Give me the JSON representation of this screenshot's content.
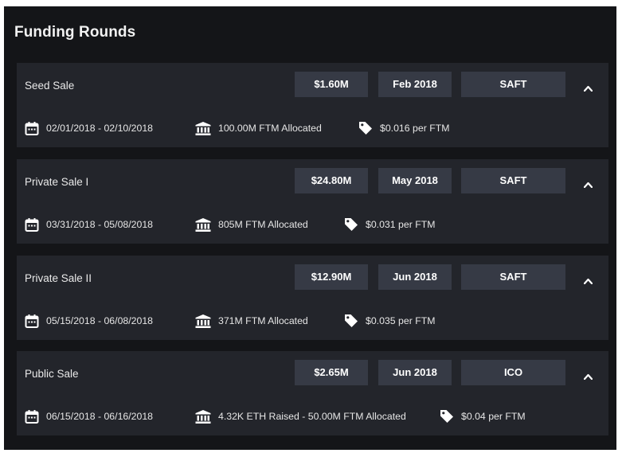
{
  "page": {
    "title": "Funding Rounds"
  },
  "icons": {
    "period": "calendar-icon",
    "allocation": "bank-icon",
    "price": "price-tag-icon",
    "toggle": "chevron-up-icon"
  },
  "colors": {
    "panel_background": "#141518",
    "card_background": "#23252b",
    "tag_background": "#363a45",
    "text": "#e9e9e9"
  },
  "rounds": [
    {
      "name": "Seed Sale",
      "amount": "$1.60M",
      "date": "Feb 2018",
      "type": "SAFT",
      "period": "02/01/2018 - 02/10/2018",
      "allocation": "100.00M FTM Allocated",
      "price": "$0.016 per FTM",
      "expanded": true
    },
    {
      "name": "Private Sale I",
      "amount": "$24.80M",
      "date": "May 2018",
      "type": "SAFT",
      "period": "03/31/2018 - 05/08/2018",
      "allocation": "805M FTM Allocated",
      "price": "$0.031 per FTM",
      "expanded": true
    },
    {
      "name": "Private Sale II",
      "amount": "$12.90M",
      "date": "Jun 2018",
      "type": "SAFT",
      "period": "05/15/2018 - 06/08/2018",
      "allocation": "371M FTM Allocated",
      "price": "$0.035 per FTM",
      "expanded": true
    },
    {
      "name": "Public Sale",
      "amount": "$2.65M",
      "date": "Jun 2018",
      "type": "ICO",
      "period": "06/15/2018 - 06/16/2018",
      "allocation": "4.32K ETH Raised - 50.00M FTM Allocated",
      "price": "$0.04 per FTM",
      "expanded": true
    }
  ]
}
